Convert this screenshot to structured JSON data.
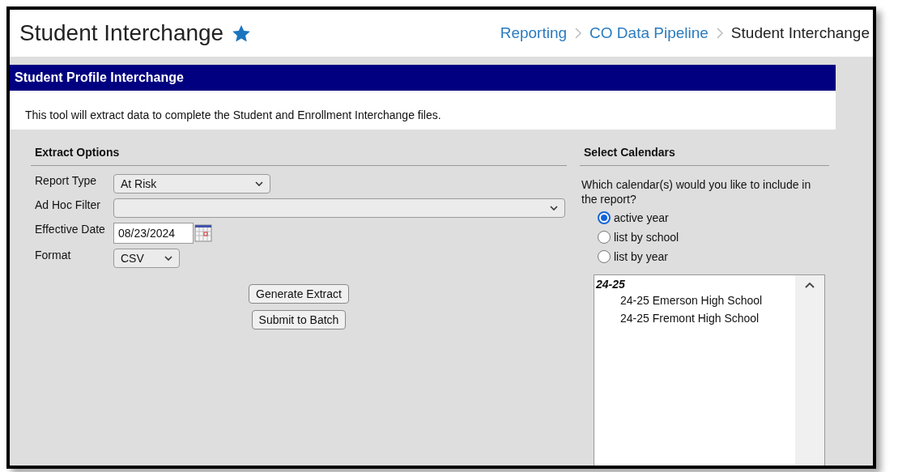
{
  "header": {
    "title": "Student Interchange",
    "breadcrumbs": [
      {
        "label": "Reporting",
        "kind": "link"
      },
      {
        "label": "CO Data Pipeline",
        "kind": "link"
      },
      {
        "label": "Student Interchange",
        "kind": "current"
      }
    ]
  },
  "section_title": "Student Profile Interchange",
  "description": "This tool will extract data to complete the Student and Enrollment Interchange files.",
  "extract_options": {
    "heading": "Extract Options",
    "fields": [
      {
        "label": "Report Type",
        "kind": "select",
        "value": "At Risk"
      },
      {
        "label": "Ad Hoc Filter",
        "kind": "select"
      },
      {
        "label": "Effective Date",
        "kind": "date",
        "value": "08/23/2024"
      },
      {
        "label": "Format",
        "kind": "select",
        "value": "CSV"
      }
    ],
    "buttons": [
      "Generate Extract",
      "Submit to Batch"
    ]
  },
  "select_calendars": {
    "heading": "Select Calendars",
    "question": "Which calendar(s) would you like to include in the report?",
    "options": [
      {
        "label": "active year",
        "selected": true
      },
      {
        "label": "list by school",
        "selected": false
      },
      {
        "label": "list by year",
        "selected": false
      }
    ],
    "calendar_list": [
      {
        "label": "24-25",
        "children": [
          {
            "label": "24-25 Emerson High School"
          },
          {
            "label": "24-25 Fremont High School"
          }
        ]
      }
    ]
  }
}
